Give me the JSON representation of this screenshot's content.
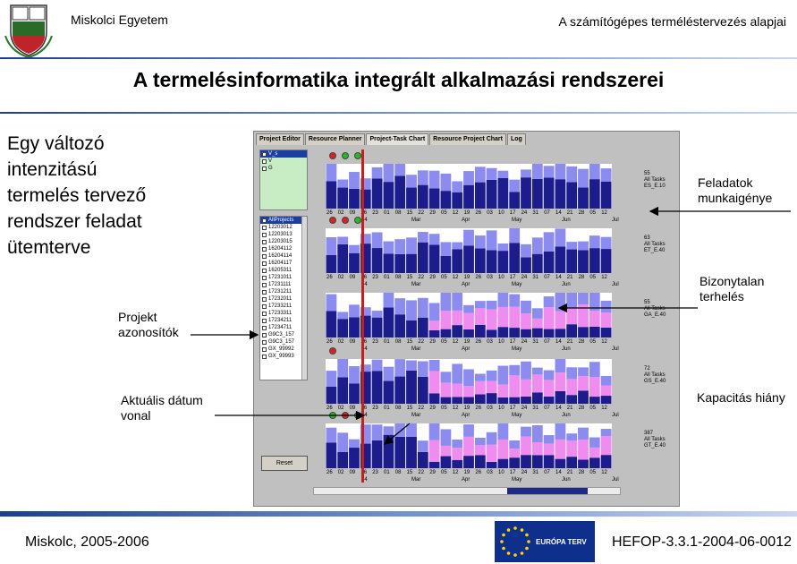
{
  "header": {
    "university": "Miskolci Egyetem",
    "course": "A számítógépes terméléstervezés alapjai"
  },
  "title": "A termelésinformatika integrált alkalmazási rendszerei",
  "left_text": "Egy változó intenzitású termelés tervező rendszer feladat ütemterve",
  "callouts": {
    "workload": "Feladatok munkaigénye",
    "uncertain": "Bizonytalan terhelés",
    "project_ids": "Projekt azonosítók",
    "date_line": "Aktuális dátum vonal",
    "capacity": "Kapacitás hiány"
  },
  "app": {
    "tabs": [
      "Project Editor",
      "Resource Planner",
      "Project-Task Chart",
      "Resource Project Chart",
      "Log"
    ],
    "active_tab": 2,
    "filter_items": [
      "V_s",
      "V",
      "G"
    ],
    "project_list": [
      "AllProjects",
      "12203012",
      "12203013",
      "12203015",
      "16204112",
      "16204114",
      "16204117",
      "16205311",
      "17231011",
      "17231111",
      "17231211",
      "17232011",
      "17233211",
      "17233311",
      "17234211",
      "17234711",
      "G9C3_157",
      "G9C3_157",
      "GX_99992",
      "GX_99993"
    ],
    "reset_label": "Reset",
    "rows": [
      {
        "count": "55",
        "tasks": "All Tasks",
        "code": "ES_E.10",
        "dots": [
          "#e02020",
          "#22bb22",
          "#22bb22"
        ]
      },
      {
        "count": "63",
        "tasks": "All Tasks",
        "code": "ET_E.40",
        "dots": [
          "#e02020",
          "#e02020",
          "#22bb22"
        ]
      },
      {
        "count": "55",
        "tasks": "All Tasks",
        "code": "GA_E.40",
        "dots": []
      },
      {
        "count": "72",
        "tasks": "All Tasks",
        "code": "GS_E.40",
        "dots": [
          "#e02020"
        ]
      },
      {
        "count": "387",
        "tasks": "All Tasks",
        "code": "GT_E.40",
        "dots": [
          "#22bb22",
          "#e02020",
          "#22bb22"
        ]
      }
    ],
    "date_ticks": [
      "26",
      "02",
      "09",
      "16",
      "23",
      "01",
      "08",
      "15",
      "22",
      "29",
      "05",
      "12",
      "19",
      "26",
      "03",
      "10",
      "17",
      "24",
      "31",
      "07",
      "14",
      "21",
      "28",
      "05",
      "12"
    ],
    "month_ticks": [
      "04",
      "Mar",
      "Apr",
      "May",
      "Jun",
      "Jul"
    ],
    "colors": {
      "navy": "#1c1c8c",
      "lavender": "#8c8cf0",
      "pink": "#f08cf0",
      "red_line": "#c02020"
    }
  },
  "footer": {
    "city_years": "Miskolc, 2005-2006",
    "eu_text": "EURÓPA TERV",
    "project_code": "HEFOP-3.3.1-2004-06-0012"
  }
}
